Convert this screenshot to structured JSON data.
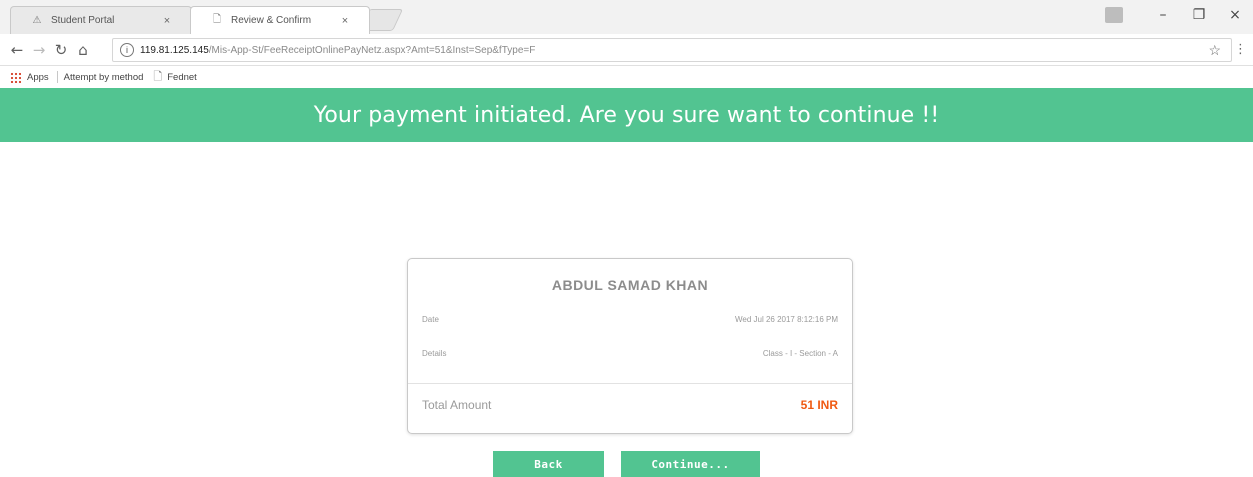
{
  "browser": {
    "tabs": [
      {
        "title": "Student Portal",
        "close": "×",
        "active": false
      },
      {
        "title": "Review & Confirm",
        "close": "×",
        "active": true
      }
    ],
    "window_controls": {
      "minimize": "–",
      "maximize": "❐",
      "close": "×"
    },
    "address": {
      "host": "119.81.125.145",
      "path": "/Mis-App-St/FeeReceiptOnlinePayNetz.aspx?Amt=51&Inst=Sep&fType=F"
    },
    "bookmarks": [
      "Apps",
      "Attempt by method",
      "Fednet"
    ]
  },
  "banner": {
    "message": "Your payment initiated. Are you sure want to continue !!",
    "color": "#52c491"
  },
  "receipt": {
    "name": "ABDUL SAMAD KHAN",
    "date_label": "Date",
    "date_value": "Wed Jul 26 2017 8:12:16 PM",
    "details_label": "Details",
    "details_value": "Class - I - Section - A",
    "total_label": "Total Amount",
    "total_value": "51 INR",
    "total_color": "#f05a12"
  },
  "actions": {
    "back_label": "Back",
    "continue_label": "Continue...",
    "button_color": "#52c491"
  }
}
